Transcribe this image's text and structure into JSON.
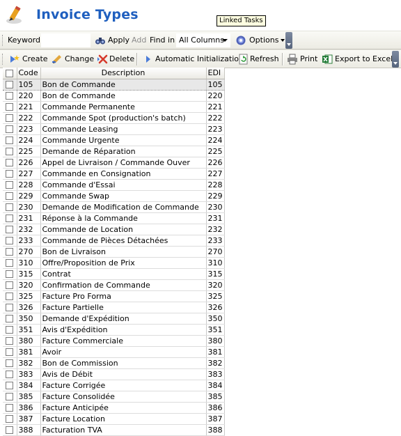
{
  "window": {
    "title": "Invoice Types",
    "tooltip": "Linked Tasks"
  },
  "search_toolbar": {
    "keyword_label": "Keyword",
    "keyword_value": "",
    "apply_label": "Apply",
    "add_label": "Add",
    "find_in_label": "Find in",
    "find_in_selected": "All Columns",
    "options_label": "Options"
  },
  "action_toolbar": {
    "create_label": "Create",
    "change_label": "Change",
    "delete_label": "Delete",
    "auto_init_label": "Automatic Initialization",
    "refresh_label": "Refresh",
    "print_label": "Print",
    "export_label": "Export to Excel"
  },
  "grid": {
    "columns": {
      "code": "Code",
      "description": "Description",
      "edi": "EDI"
    },
    "rows": [
      {
        "code": "105",
        "description": "Bon de Commande",
        "edi": "105"
      },
      {
        "code": "220",
        "description": "Bon de Commande",
        "edi": "220"
      },
      {
        "code": "221",
        "description": "Commande Permanente",
        "edi": "221"
      },
      {
        "code": "222",
        "description": "Commande Spot (production's batch)",
        "edi": "222"
      },
      {
        "code": "223",
        "description": "Commande Leasing",
        "edi": "223"
      },
      {
        "code": "224",
        "description": "Commande Urgente",
        "edi": "224"
      },
      {
        "code": "225",
        "description": "Demande de Réparation",
        "edi": "225"
      },
      {
        "code": "226",
        "description": "Appel de Livraison / Commande Ouver",
        "edi": "226"
      },
      {
        "code": "227",
        "description": "Commande en Consignation",
        "edi": "227"
      },
      {
        "code": "228",
        "description": "Commande d'Essai",
        "edi": "228"
      },
      {
        "code": "229",
        "description": "Commande Swap",
        "edi": "229"
      },
      {
        "code": "230",
        "description": "Demande de Modification de Commande",
        "edi": "230"
      },
      {
        "code": "231",
        "description": "Réponse à la Commande",
        "edi": "231"
      },
      {
        "code": "232",
        "description": "Commande de Location",
        "edi": "232"
      },
      {
        "code": "233",
        "description": "Commande de Pièces Détachées",
        "edi": "233"
      },
      {
        "code": "270",
        "description": "Bon de Livraison",
        "edi": "270"
      },
      {
        "code": "310",
        "description": "Offre/Proposition de Prix",
        "edi": "310"
      },
      {
        "code": "315",
        "description": "Contrat",
        "edi": "315"
      },
      {
        "code": "320",
        "description": "Confirmation de Commande",
        "edi": "320"
      },
      {
        "code": "325",
        "description": "Facture Pro Forma",
        "edi": "325"
      },
      {
        "code": "326",
        "description": "Facture Partielle",
        "edi": "326"
      },
      {
        "code": "350",
        "description": "Demande d'Expédition",
        "edi": "350"
      },
      {
        "code": "351",
        "description": "Avis d'Expédition",
        "edi": "351"
      },
      {
        "code": "380",
        "description": "Facture Commerciale",
        "edi": "380"
      },
      {
        "code": "381",
        "description": "Avoir",
        "edi": "381"
      },
      {
        "code": "382",
        "description": "Bon de Commission",
        "edi": "382"
      },
      {
        "code": "383",
        "description": "Avis de Débit",
        "edi": "383"
      },
      {
        "code": "384",
        "description": "Facture Corrigée",
        "edi": "384"
      },
      {
        "code": "385",
        "description": "Facture Consolidée",
        "edi": "385"
      },
      {
        "code": "386",
        "description": "Facture Anticipée",
        "edi": "386"
      },
      {
        "code": "387",
        "description": "Facture Location",
        "edi": "387"
      },
      {
        "code": "388",
        "description": "Facturation TVA",
        "edi": "388"
      }
    ]
  },
  "icons": {
    "title": "pencil-icon",
    "apply": "binoculars-icon",
    "options": "gear-icon",
    "create": "create-icon",
    "change": "edit-pencil-icon",
    "delete": "delete-x-icon",
    "auto_init": "arrow-right-icon",
    "refresh": "refresh-icon",
    "print": "printer-icon",
    "export": "excel-icon"
  },
  "colors": {
    "title": "#1f5fbf",
    "tooltip_bg": "#ffffe1"
  }
}
